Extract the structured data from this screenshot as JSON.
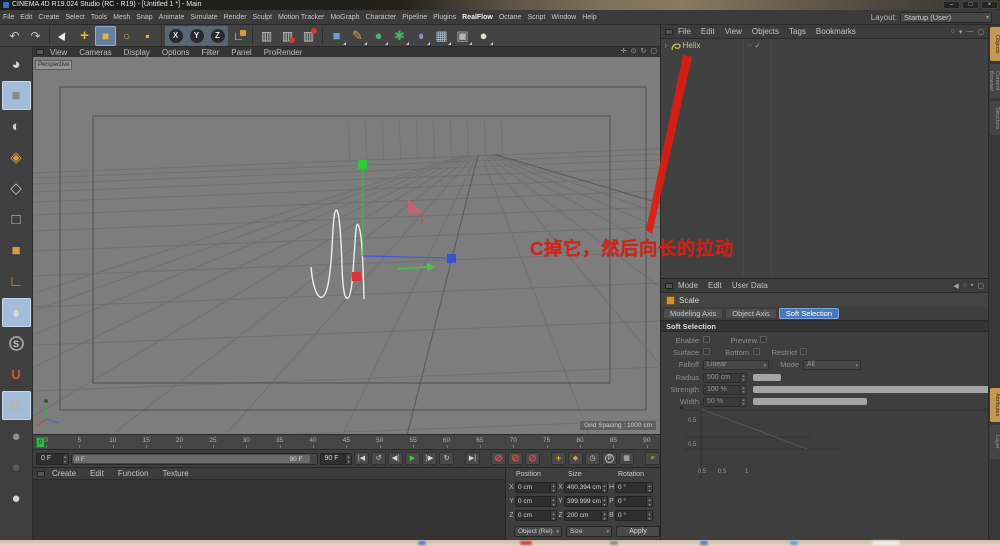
{
  "window": {
    "title": "CINEMA 4D R19.024 Studio (RC - R19) - [Untitled 1 *] - Main",
    "minimize": "–",
    "maximize": "□",
    "close": "×"
  },
  "menubar": {
    "items": [
      "File",
      "Edit",
      "Create",
      "Select",
      "Tools",
      "Mesh",
      "Snap",
      "Animate",
      "Simulate",
      "Render",
      "Sculpt",
      "Motion Tracker",
      "MoGraph",
      "Character",
      "Pipeline",
      "Plugins",
      "RealFlow",
      "Octane",
      "Script",
      "Window",
      "Help"
    ],
    "highlight": "RealFlow",
    "layout_label": "Layout:",
    "layout_value": "Startup (User)"
  },
  "toolbar": {
    "icons": [
      {
        "n": "undo",
        "g": "↶",
        "c": "#c6c6c6"
      },
      {
        "n": "redo",
        "g": "↷",
        "c": "#c6c6c6"
      },
      {
        "n": "sep"
      },
      {
        "n": "live-selection",
        "g": "▶",
        "c": "#ececec",
        "cls": "cursor"
      },
      {
        "n": "move-tool",
        "g": "+",
        "c": "#e6b23c",
        "cls": "bold16"
      },
      {
        "n": "scale-tool",
        "g": "■",
        "c": "#e6b23c",
        "active": true
      },
      {
        "n": "rotate-tool",
        "g": "○",
        "c": "#e6b23c",
        "cls": "bold"
      },
      {
        "n": "last-used-tool",
        "g": "▪",
        "c": "#e6b23c"
      },
      {
        "n": "sep"
      },
      {
        "n": "x-axis-lock",
        "g": "X",
        "cls": "axis"
      },
      {
        "n": "y-axis-lock",
        "g": "Y",
        "cls": "axis"
      },
      {
        "n": "z-axis-lock",
        "g": "Z",
        "cls": "axis"
      },
      {
        "n": "coordinate-system",
        "g": "∟",
        "c": "#cccccc",
        "cls": "coord"
      },
      {
        "n": "sep"
      },
      {
        "n": "render-view",
        "g": "▥",
        "c": "#c9c9c9"
      },
      {
        "n": "render-to-picture-viewer",
        "g": "▥",
        "c": "#c9c9c9",
        "cls": "reddot"
      },
      {
        "n": "render-settings",
        "g": "▥",
        "c": "#c9c9c9",
        "cls": "reddot2"
      },
      {
        "n": "sep"
      },
      {
        "n": "add-primitive-cube",
        "g": "■",
        "c": "#6d9bd3",
        "cls": "dd"
      },
      {
        "n": "add-spline-pen",
        "g": "✎",
        "c": "#e2a03c",
        "cls": "dd"
      },
      {
        "n": "add-generator",
        "g": "●",
        "c": "#4cb46a",
        "cls": "dd"
      },
      {
        "n": "add-deformer",
        "g": "✱",
        "c": "#49b45f",
        "cls": "dd"
      },
      {
        "n": "add-environment",
        "g": "●",
        "c": "#9188cc",
        "cls": "dd env"
      },
      {
        "n": "add-floor",
        "g": "▦",
        "c": "#a9bdd2",
        "cls": "dd"
      },
      {
        "n": "add-camera",
        "g": "▣",
        "c": "#b5b5b5",
        "cls": "dd"
      },
      {
        "n": "add-light",
        "g": "●",
        "c": "#e6dfc6",
        "cls": "dd"
      }
    ]
  },
  "left_dock": {
    "icons": [
      {
        "n": "interactive-render-region",
        "g": "◕",
        "c": "#cfcfcf"
      },
      {
        "n": "make-editable",
        "g": "■",
        "c": "#8a8a8a",
        "active": true
      },
      {
        "n": "model-mode",
        "g": "◐",
        "c": "#c9c9c9"
      },
      {
        "n": "texture-mode",
        "g": "◈",
        "c": "#d79b3c"
      },
      {
        "n": "axis-mode",
        "g": "◇",
        "c": "#bfbfbf"
      },
      {
        "n": "points-mode",
        "g": "□",
        "c": "#bfbfbf"
      },
      {
        "n": "polygons-mode",
        "g": "■",
        "c": "#d79b3c"
      },
      {
        "n": "workplane-mode",
        "g": "∟",
        "c": "#d79b3c"
      },
      {
        "n": "viewport-solo",
        "g": "●",
        "c": "#d8d8d8",
        "active": true,
        "cls": "mouse"
      },
      {
        "n": "snap-toggle",
        "g": "S",
        "cls": "scircle"
      },
      {
        "n": "magnet-tool",
        "g": "∪",
        "c": "#cc5a30",
        "cls": "bold"
      },
      {
        "n": "workplane-lock",
        "g": "▦",
        "c": "#b5b5b5",
        "active": true
      },
      {
        "n": "lock-toggle",
        "g": "●",
        "c": "#8f8f8f"
      },
      {
        "n": "sphere-dark",
        "g": "●",
        "c": "#5a5a5a"
      },
      {
        "n": "sphere-light",
        "g": "●",
        "c": "#d5d5d5"
      }
    ]
  },
  "viewport": {
    "menu": [
      "View",
      "Cameras",
      "Display",
      "Options",
      "Filter",
      "Panel",
      "ProRender"
    ],
    "camera_label": "Perspective",
    "grid_spacing": "Grid Spacing : 1000 cm",
    "corner_icons": [
      {
        "n": "pan-view",
        "g": "✛"
      },
      {
        "n": "zoom-view",
        "g": "⊙"
      },
      {
        "n": "rotate-view",
        "g": "↻"
      },
      {
        "n": "toggle-view",
        "g": "▢"
      }
    ]
  },
  "annotation": {
    "text": "C掉它，然后向长的拉动",
    "color": "#cc2418"
  },
  "timeline": {
    "ticks": [
      "0",
      "5",
      "10",
      "15",
      "20",
      "25",
      "30",
      "35",
      "40",
      "45",
      "50",
      "55",
      "60",
      "65",
      "70",
      "75",
      "80",
      "85",
      "90"
    ],
    "marker": "0"
  },
  "transport": {
    "start_field": "0 F",
    "end_field": "90 F",
    "range_start": "0 F",
    "range_end": "90 F",
    "buttons": [
      {
        "n": "goto-start",
        "g": "|◀"
      },
      {
        "n": "play-backwards",
        "g": "↺"
      },
      {
        "n": "prev-key",
        "g": "◀("
      },
      {
        "n": "play-forwards",
        "g": "▶",
        "c": "#45c945"
      },
      {
        "n": "next-key",
        "g": ")▶"
      },
      {
        "n": "loop",
        "g": "↻"
      },
      {
        "n": "sp"
      },
      {
        "n": "goto-end",
        "g": "▶|"
      },
      {
        "n": "sp"
      },
      {
        "n": "record-position",
        "g": "⊘",
        "c": "#d24a4a"
      },
      {
        "n": "record-scale",
        "g": "⊘",
        "c": "#d24a4a"
      },
      {
        "n": "record-rotation",
        "g": "⊘",
        "c": "#d24a4a"
      },
      {
        "n": "sp"
      },
      {
        "n": "record-keyframe",
        "g": "+",
        "c": "#e0b23c",
        "cls": "bold"
      },
      {
        "n": "autokey",
        "g": "◆",
        "c": "#e09a3c"
      },
      {
        "n": "keyframe-selection",
        "g": "◷",
        "c": "#c9c9c9"
      },
      {
        "n": "param-record",
        "g": "P",
        "cls": "pcircle"
      },
      {
        "n": "snapshot",
        "g": "▦",
        "c": "#c9c9c9"
      },
      {
        "n": "sp"
      },
      {
        "n": "timeline-options",
        "g": "≡",
        "c": "#e0b23c"
      }
    ]
  },
  "materials": {
    "menu": [
      "Create",
      "Edit",
      "Function",
      "Texture"
    ]
  },
  "coordinates": {
    "headers": [
      "Position",
      "Size",
      "Rotation"
    ],
    "rows": [
      {
        "axis": "X",
        "position": "0 cm",
        "size_axis": "X",
        "size": "400.394 cm",
        "rot_axis": "H",
        "rotation": "0 °"
      },
      {
        "axis": "Y",
        "position": "0 cm",
        "size_axis": "Y",
        "size": "399.999 cm",
        "rot_axis": "P",
        "rotation": "0 °"
      },
      {
        "axis": "Z",
        "position": "0 cm",
        "size_axis": "Z",
        "size": "200 cm",
        "rot_axis": "B",
        "rotation": "0 °"
      }
    ],
    "mode_dropdown": "Object (Rel)",
    "size_dropdown": "Size",
    "apply_label": "Apply"
  },
  "object_manager": {
    "menu": [
      "File",
      "Edit",
      "View",
      "Objects",
      "Tags",
      "Bookmarks"
    ],
    "objects": [
      {
        "name": "Helix"
      }
    ],
    "right_icons": [
      {
        "n": "om-search",
        "g": "○"
      },
      {
        "n": "om-filter",
        "g": "▾"
      },
      {
        "n": "om-minimize",
        "g": "—"
      },
      {
        "n": "om-panel",
        "g": "▢"
      }
    ]
  },
  "attribute_manager": {
    "menu": [
      "Mode",
      "Edit",
      "User Data"
    ],
    "object_label": "Scale",
    "right_icons": [
      {
        "n": "am-back",
        "g": "◀"
      },
      {
        "n": "am-search",
        "g": "○"
      },
      {
        "n": "am-lock",
        "g": "▪"
      },
      {
        "n": "am-panel",
        "g": "▢"
      }
    ],
    "tabs": [
      {
        "label": "Modeling Axis"
      },
      {
        "label": "Object Axis"
      },
      {
        "label": "Soft Selection",
        "active": true
      }
    ],
    "section": "Soft Selection",
    "params": {
      "enable_label": "Enable",
      "preview_label": "Preview",
      "surface_label": "Surface",
      "bottom_label": "Bottom",
      "restrict_label": "Restrict",
      "falloff_label": "Falloff",
      "falloff_value": "Linear",
      "mode_label": "Mode",
      "mode_value": "All",
      "radius_label": "Radius",
      "radius_value": "500 cm",
      "strength_label": "Strength",
      "strength_value": "100 %",
      "width_label": "Width",
      "width_value": "50 %"
    },
    "graph": {
      "y_ticks": [
        "0.5",
        "0.5"
      ],
      "x_ticks": [
        "0.5",
        "0.5",
        "1"
      ]
    }
  },
  "right_tabs": {
    "top": [
      {
        "label": "Objects",
        "active": true
      },
      {
        "label": "Content Browser"
      },
      {
        "label": "Structure"
      }
    ],
    "bottom": [
      {
        "label": "Attributes",
        "active": true
      },
      {
        "label": "Layer"
      }
    ]
  }
}
